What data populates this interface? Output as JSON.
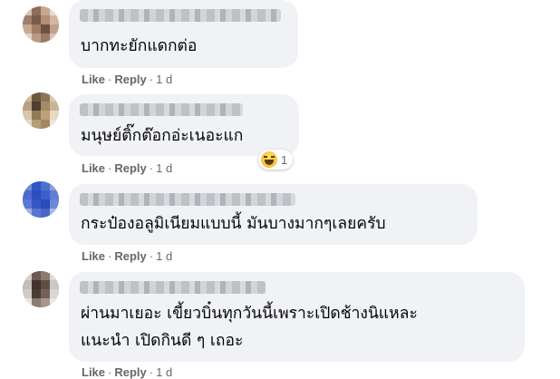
{
  "comments": [
    {
      "text_lines": [
        "บากทะยักแดกต่อ"
      ],
      "actions": {
        "like": "Like",
        "reply": "Reply",
        "time": "1 d"
      }
    },
    {
      "text_lines": [
        "มนุษย์ติ๊กต๊อกอ่ะเนอะแก"
      ],
      "actions": {
        "like": "Like",
        "reply": "Reply",
        "time": "1 d"
      },
      "reaction": {
        "icon": "haha-emoji-icon",
        "count": "1"
      }
    },
    {
      "text_lines": [
        "กระป๋องอลูมิเนียมแบบนี้ มันบางมากๆเลยครับ"
      ],
      "actions": {
        "like": "Like",
        "reply": "Reply",
        "time": "1 d"
      }
    },
    {
      "text_lines": [
        "ผ่านมาเยอะ เขี้ยวบิ๋นทุกวันนี้เพราะเปิดช้างนิแหละ",
        "แนะนำ เปิดกินดี ๆ เถอะ"
      ],
      "actions": {
        "like": "Like",
        "reply": "Reply",
        "time": "1 d"
      }
    }
  ],
  "separator": "·",
  "colors": {
    "bubble": "#f0f2f5",
    "text": "#050505",
    "meta": "#65676b"
  }
}
